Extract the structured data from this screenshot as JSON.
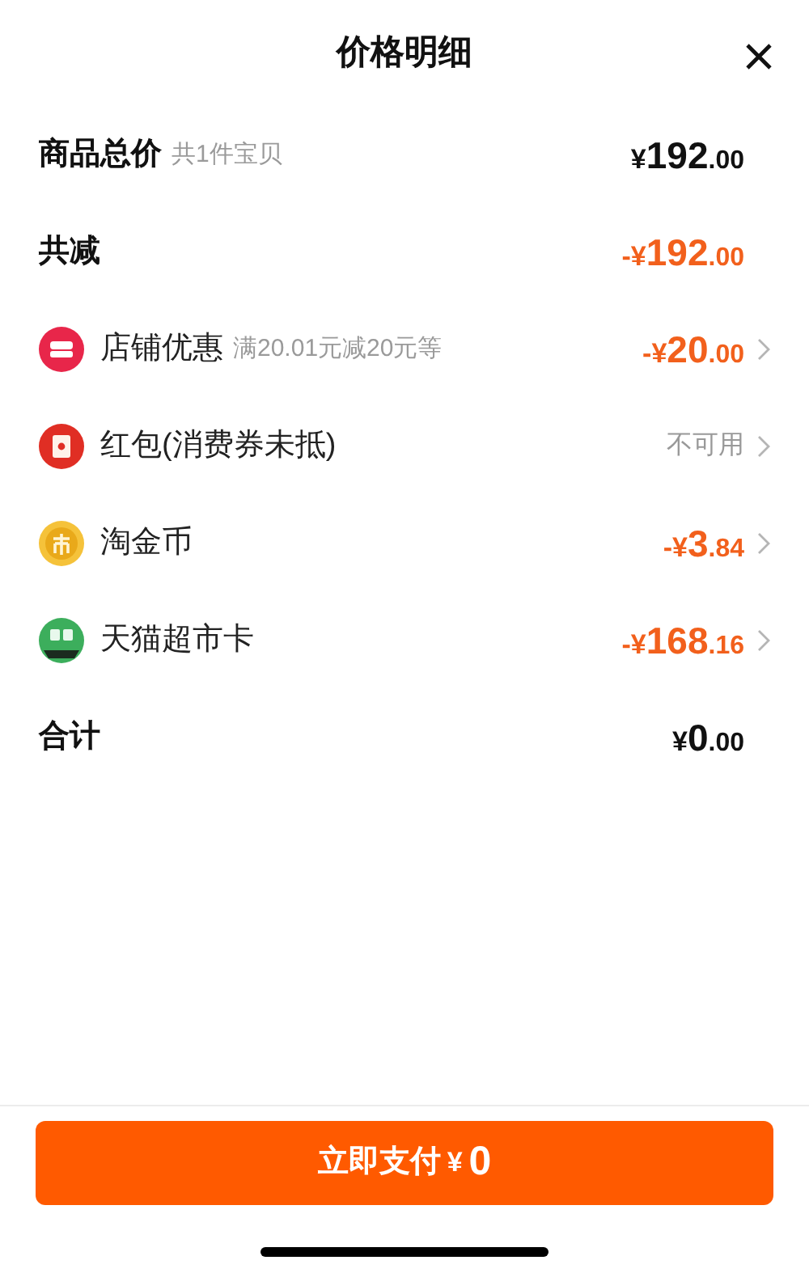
{
  "header": {
    "title": "价格明细"
  },
  "rows": [
    {
      "kind": "heading",
      "label": "商品总价",
      "note": "共1件宝贝",
      "amount": {
        "prefix": "¥",
        "integer": "192",
        "decimal": ".00"
      },
      "discount": false
    },
    {
      "kind": "heading",
      "label": "共减",
      "amount": {
        "prefix": "-¥",
        "integer": "192",
        "decimal": ".00"
      },
      "discount": true
    },
    {
      "kind": "store",
      "label": "店铺优惠",
      "note": "满20.01元减20元等",
      "amount": {
        "prefix": "-¥",
        "integer": "20",
        "decimal": ".00"
      },
      "discount": true
    },
    {
      "kind": "envelope",
      "label": "红包(消费券未抵)",
      "status": "不可用"
    },
    {
      "kind": "coin",
      "label": "淘金币",
      "amount": {
        "prefix": "-¥",
        "integer": "3",
        "decimal": ".84"
      },
      "discount": true
    },
    {
      "kind": "market",
      "label": "天猫超市卡",
      "amount": {
        "prefix": "-¥",
        "integer": "168",
        "decimal": ".16"
      },
      "discount": true
    },
    {
      "kind": "heading",
      "label": "合计",
      "amount": {
        "prefix": "¥",
        "integer": "0",
        "decimal": ".00"
      },
      "discount": false
    }
  ],
  "pay_button": {
    "label": "立即支付",
    "currency": "¥",
    "amount": "0"
  }
}
